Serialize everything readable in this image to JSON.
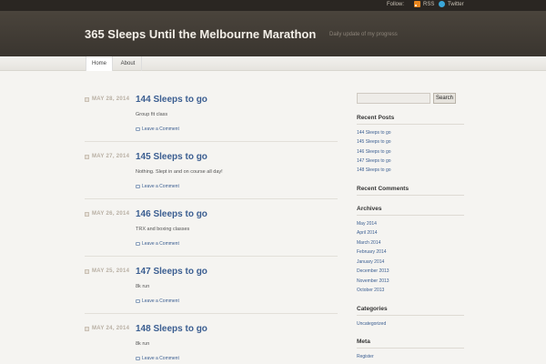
{
  "topbar": {
    "follow_label": "Follow:",
    "rss_label": "RSS",
    "twitter_label": "Twitter"
  },
  "header": {
    "site_title": "365 Sleeps Until the Melbourne Marathon",
    "site_description": "Daily update of my progress"
  },
  "nav": {
    "items": [
      {
        "label": "Home"
      },
      {
        "label": "About"
      }
    ]
  },
  "posts": [
    {
      "date": "MAY 28, 2014",
      "title": "144 Sleeps to go",
      "excerpt": "Group fit class",
      "comments": "Leave a Comment"
    },
    {
      "date": "MAY 27, 2014",
      "title": "145 Sleeps to go",
      "excerpt": "Nothing. Slept in and on course all day!",
      "comments": "Leave a Comment"
    },
    {
      "date": "MAY 26, 2014",
      "title": "146 Sleeps to go",
      "excerpt": "TRX and boxing classes",
      "comments": "Leave a Comment"
    },
    {
      "date": "MAY 25, 2014",
      "title": "147 Sleeps to go",
      "excerpt": "8k run",
      "comments": "Leave a Comment"
    },
    {
      "date": "MAY 24, 2014",
      "title": "148 Sleeps to go",
      "excerpt": "8k run",
      "comments": "Leave a Comment"
    }
  ],
  "sidebar": {
    "search_button": "Search",
    "recent_posts": {
      "title": "Recent Posts",
      "items": [
        "144 Sleeps to go",
        "145 Sleeps to go",
        "146 Sleeps to go",
        "147 Sleeps to go",
        "148 Sleeps to go"
      ]
    },
    "recent_comments": {
      "title": "Recent Comments"
    },
    "archives": {
      "title": "Archives",
      "items": [
        "May 2014",
        "April 2014",
        "March 2014",
        "February 2014",
        "January 2014",
        "December 2013",
        "November 2013",
        "October 2013"
      ]
    },
    "categories": {
      "title": "Categories",
      "items": [
        "Uncategorized"
      ]
    },
    "meta": {
      "title": "Meta",
      "items": [
        "Register"
      ]
    }
  },
  "colors": {
    "link": "#3b5e91",
    "header_bg": "#3f3a34",
    "topbar_bg": "#2a2622",
    "page_bg": "#f5f4f1"
  }
}
